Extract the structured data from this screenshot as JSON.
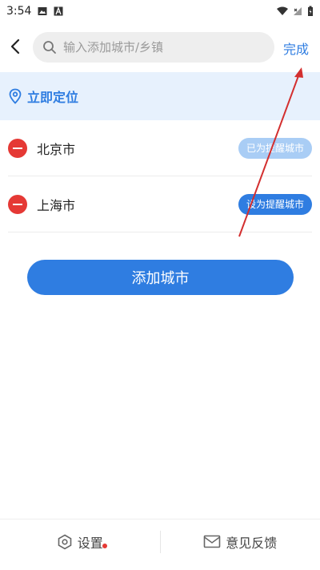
{
  "status_bar": {
    "time": "3:54"
  },
  "header": {
    "search_placeholder": "输入添加城市/乡镇",
    "done_label": "完成"
  },
  "locate": {
    "label": "立即定位"
  },
  "cities": [
    {
      "name": "北京市",
      "remind_label": "已为提醒城市",
      "remind_active": true
    },
    {
      "name": "上海市",
      "remind_label": "设为提醒城市",
      "remind_active": false
    }
  ],
  "add_button": {
    "label": "添加城市"
  },
  "bottom_bar": {
    "settings_label": "设置",
    "feedback_label": "意见反馈"
  },
  "colors": {
    "accent": "#2f7de1",
    "accent_light": "#a9cdf5",
    "danger": "#e53935",
    "locate_bg": "#e7f1fd"
  }
}
